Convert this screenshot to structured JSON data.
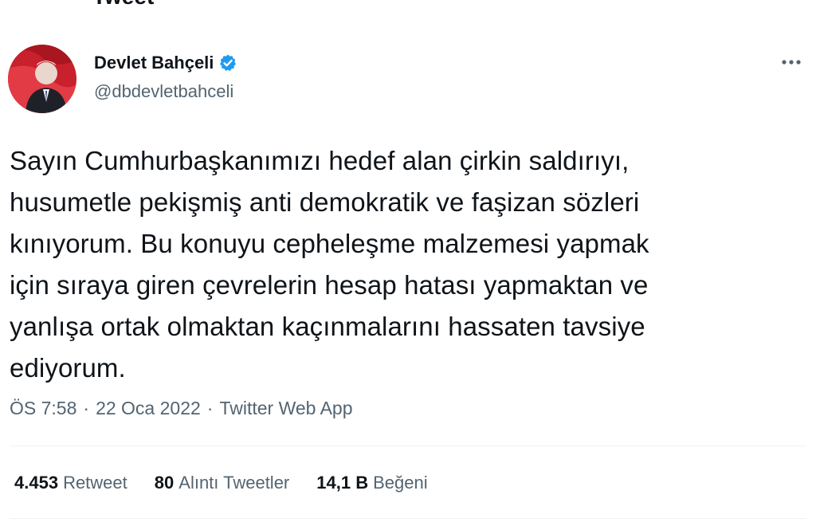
{
  "header": {
    "title": "Tweet"
  },
  "author": {
    "name": "Devlet Bahçeli",
    "handle": "@dbdevletbahceli",
    "verified": true,
    "verified_color": "#1d9bf0"
  },
  "tweet": {
    "lines": [
      "Sayın Cumhurbaşkanımızı hedef alan çirkin saldırıyı,",
      "husumetle pekişmiş anti demokratik ve faşizan sözleri",
      "kınıyorum. Bu konuyu cepheleşme malzemesi yapmak",
      "için sıraya giren çevrelerin hesap hatası yapmaktan ve",
      "yanlışa ortak olmaktan kaçınmalarını hassaten tavsiye",
      "ediyorum."
    ]
  },
  "meta": {
    "time": "ÖS 7:58",
    "sep1": "·",
    "date": "22 Oca 2022",
    "sep2": "·",
    "source": "Twitter Web App"
  },
  "stats": {
    "retweets": {
      "value": "4.453",
      "label": "Retweet"
    },
    "quotes": {
      "value": "80",
      "label": "Alıntı Tweetler"
    },
    "likes": {
      "value": "14,1 B",
      "label": "Beğeni"
    }
  },
  "icons": {
    "more": "more-horizontal-icon",
    "verified": "verified-badge-icon"
  },
  "colors": {
    "text": "#0f1419",
    "secondary": "#536471",
    "divider": "#eff3f4",
    "brand": "#1d9bf0"
  }
}
